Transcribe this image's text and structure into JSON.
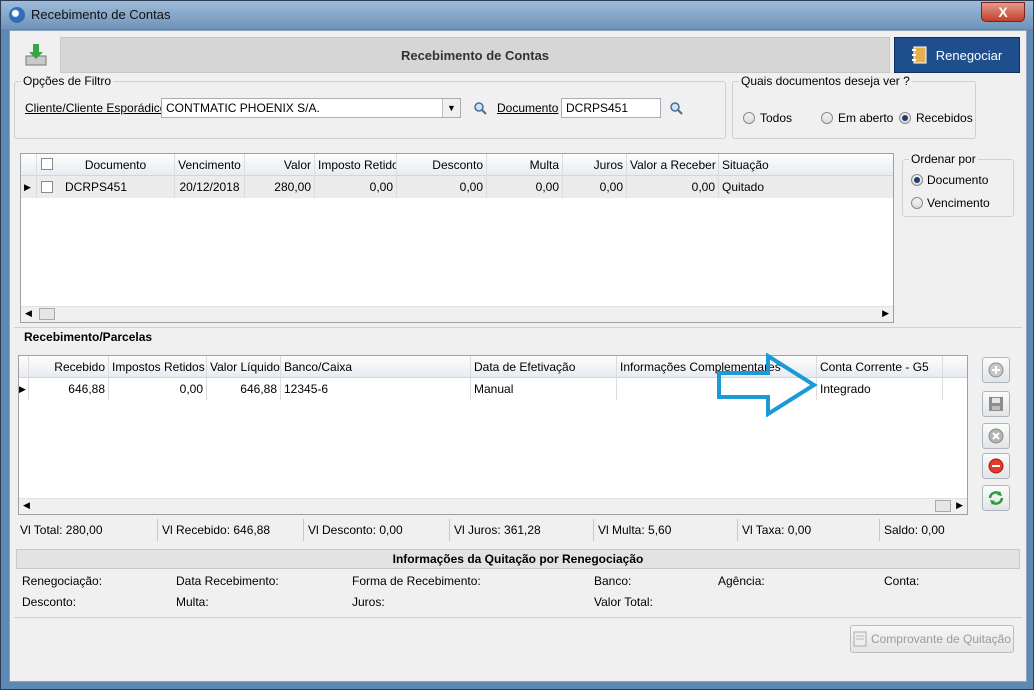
{
  "window": {
    "title": "Recebimento de Contas",
    "close": "X"
  },
  "header": {
    "title": "Recebimento de Contas",
    "renegociar": "Renegociar"
  },
  "filtro": {
    "group_label": "Opções de Filtro",
    "cliente_label": "Cliente/Cliente Esporádico",
    "cliente_value": "CONTMATIC PHOENIX S/A.",
    "documento_label": "Documento",
    "documento_value": "DCRPS451"
  },
  "docs": {
    "group_label": "Quais documentos deseja ver ?",
    "options": [
      "Todos",
      "Em aberto",
      "Recebidos"
    ],
    "selected": "Recebidos"
  },
  "ordenar": {
    "group_label": "Ordenar por",
    "options": [
      "Documento",
      "Vencimento"
    ],
    "selected": "Documento"
  },
  "contas_table": {
    "columns": [
      "Documento",
      "Vencimento",
      "Valor",
      "Imposto Retido",
      "Desconto",
      "Multa",
      "Juros",
      "Valor a Receber",
      "Situação"
    ],
    "rows": [
      [
        "DCRPS451",
        "20/12/2018",
        "280,00",
        "0,00",
        "0,00",
        "0,00",
        "0,00",
        "0,00",
        "Quitado"
      ]
    ]
  },
  "parcelas": {
    "section_label": "Recebimento/Parcelas",
    "columns": [
      "Recebido",
      "Impostos Retidos",
      "Valor Líquido",
      "Banco/Caixa",
      "Data de Efetivação",
      "Informações Complementares",
      "Conta Corrente - G5"
    ],
    "rows": [
      [
        "646,88",
        "0,00",
        "646,88",
        "12345-6",
        "Manual",
        "",
        "Integrado"
      ]
    ]
  },
  "totais": [
    "Vl Total: 280,00",
    "Vl Recebido: 646,88",
    "Vl Desconto: 0,00",
    "Vl Juros: 361,28",
    "Vl Multa: 5,60",
    "Vl Taxa: 0,00",
    "Saldo: 0,00"
  ],
  "quitacao": {
    "title": "Informações da Quitação por Renegociação",
    "labels": [
      "Renegociação:",
      "Data Recebimento:",
      "Forma de Recebimento:",
      "Banco:",
      "Agência:",
      "Conta:",
      "Desconto:",
      "Multa:",
      "Juros:",
      "Valor Total:"
    ]
  },
  "comprovante": "Comprovante de Quitação",
  "colors": {
    "accent": "#1f4e8c",
    "arrow": "#1a9ad6"
  }
}
